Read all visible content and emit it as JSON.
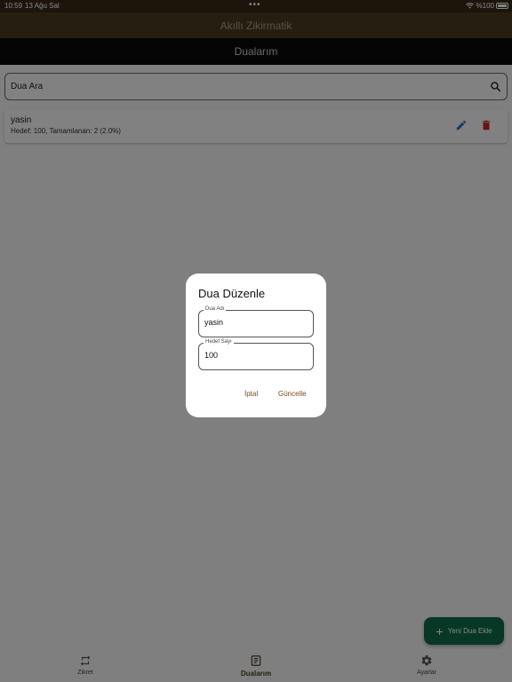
{
  "status_bar": {
    "time": "10:59",
    "date": "13 Ağu Sal",
    "dots": "•••",
    "battery": "%100",
    "icons": [
      "wifi-icon",
      "battery-icon"
    ]
  },
  "app": {
    "title": "Akıllı Zikirmatik",
    "section_title": "Dualarım"
  },
  "search": {
    "placeholder": "Dua Ara",
    "icon": "search-icon"
  },
  "list": [
    {
      "title": "yasin",
      "subtitle": "Hedef: 100, Tamamlanan: 2 (2.0%)"
    }
  ],
  "fab": {
    "label": "Yeni Dua Ekle",
    "icon": "plus-icon"
  },
  "bottom_nav": [
    {
      "label": "Zikret",
      "icon": "repeat-icon",
      "active": false
    },
    {
      "label": "Dualarım",
      "icon": "list-icon",
      "active": true
    },
    {
      "label": "Ayarlar",
      "icon": "gear-icon",
      "active": false
    }
  ],
  "dialog": {
    "title": "Dua Düzenle",
    "name_label": "Dua Adı",
    "name_value": "yasin",
    "target_label": "Hedef Sayı",
    "target_value": "100",
    "cancel_label": "İptal",
    "update_label": "Güncelle"
  },
  "colors": {
    "status_bar": "#362918",
    "app_bar": "#4c3a23",
    "sub_bar": "#0b0b0b",
    "fab": "#0f6b47",
    "edit_icon": "#2a6fc0",
    "delete_icon": "#c62828",
    "dialog_button": "#7a4a1e"
  }
}
